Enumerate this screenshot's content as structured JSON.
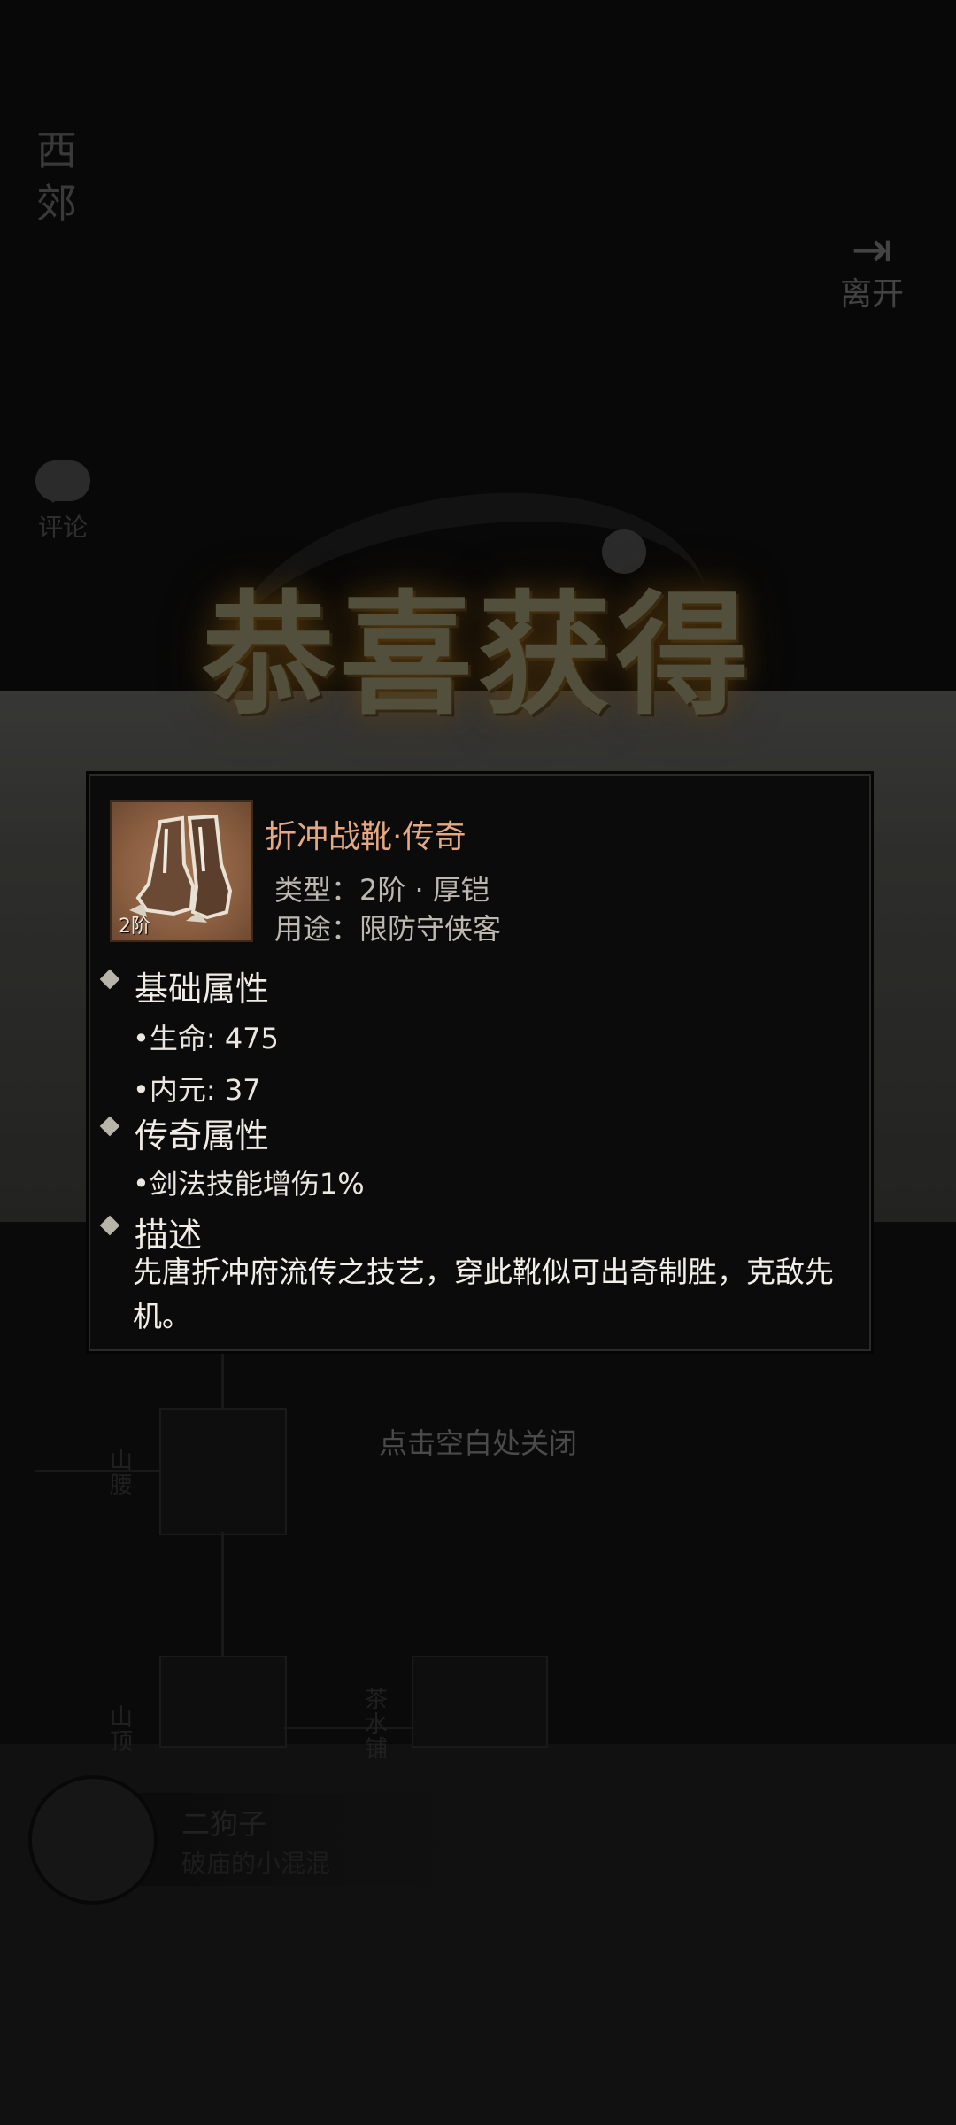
{
  "location": {
    "title": "西郊"
  },
  "exit": {
    "label": "离开"
  },
  "comment": {
    "label": "评论"
  },
  "banner": {
    "text": "恭喜获得"
  },
  "map": {
    "labels": [
      "山腰",
      "山顶",
      "茶水铺"
    ]
  },
  "npc": {
    "name": "二狗子",
    "subtitle": "破庙的小混混"
  },
  "item": {
    "name": "折冲战靴·传奇",
    "tier_badge": "2阶",
    "type_line": "类型：2阶 · 厚铠",
    "usage_line": "用途：限防守侠客",
    "name_color": "#e3a983",
    "icon": "boots-icon"
  },
  "sections": {
    "base": {
      "title": "基础属性",
      "stats": [
        "•生命: 475",
        "•内元: 37"
      ]
    },
    "legend": {
      "title": "传奇属性",
      "stats": [
        "•剑法技能增伤1%"
      ]
    },
    "desc": {
      "title": "描述",
      "text": "先唐折冲府流传之技艺，穿此靴似可出奇制胜，克敌先机。"
    }
  },
  "close_hint": "点击空白处关闭"
}
